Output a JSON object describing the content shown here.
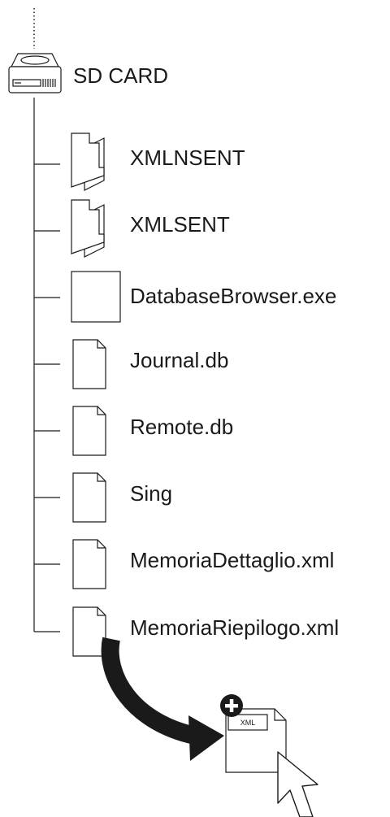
{
  "drive": {
    "label": "SD CARD",
    "icon": "sd-card-drive-icon"
  },
  "items": [
    {
      "label": "XMLNSENT",
      "icon": "folder-icon"
    },
    {
      "label": "XMLSENT",
      "icon": "folder-icon"
    },
    {
      "label": "DatabaseBrowser.exe",
      "icon": "application-icon"
    },
    {
      "label": "Journal.db",
      "icon": "file-icon"
    },
    {
      "label": "Remote.db",
      "icon": "file-icon"
    },
    {
      "label": "Sing",
      "icon": "file-icon"
    },
    {
      "label": "MemoriaDettaglio.xml",
      "icon": "file-icon"
    },
    {
      "label": "MemoriaRiepilogo.xml",
      "icon": "file-icon"
    }
  ],
  "drag": {
    "file_badge": "XML",
    "icons": [
      "drag-arrow-icon",
      "add-plus-icon",
      "mouse-pointer-icon"
    ]
  }
}
